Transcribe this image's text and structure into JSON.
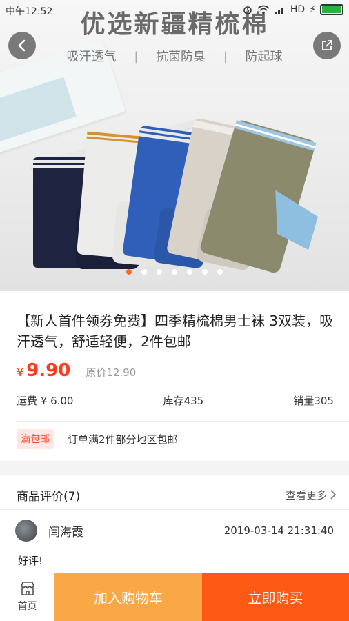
{
  "status_bar": {
    "time": "中午12:52",
    "network": "HD"
  },
  "banner": {
    "headline": "优选新疆精梳棉",
    "tags": [
      "吸汗透气",
      "抗菌防臭",
      "防起球"
    ],
    "tag_separator": "|",
    "carousel_total": 7,
    "carousel_active": 1
  },
  "product": {
    "title": "【新人首件领券免费】四季精梳棉男士袜 3双装，吸汗透气，舒适轻便，2件包邮",
    "currency": "¥",
    "price": "9.90",
    "original_price": "原价12.90",
    "shipping_fee": "运费 ¥ 6.00",
    "stock": "库存435",
    "sales": "销量305",
    "shipping_tag": "满包邮",
    "shipping_note": "订单满2件部分地区包邮"
  },
  "reviews": {
    "title": "商品评价(7)",
    "more_label": "查看更多",
    "items": [
      {
        "name": "闫海霞",
        "date": "2019-03-14 21:31:40",
        "text": "好评!"
      }
    ]
  },
  "bottom_bar": {
    "home_label": "首页",
    "add_to_cart": "加入购物车",
    "buy_now": "立即购买"
  },
  "colors": {
    "accent": "#ff3b1f",
    "cart_button": "#f9a845",
    "buy_button": "#ff5a14"
  },
  "icons": [
    "back-arrow-icon",
    "share-icon",
    "chevron-right-icon",
    "shop-icon",
    "battery-icon",
    "wifi-icon",
    "alarm-icon"
  ]
}
